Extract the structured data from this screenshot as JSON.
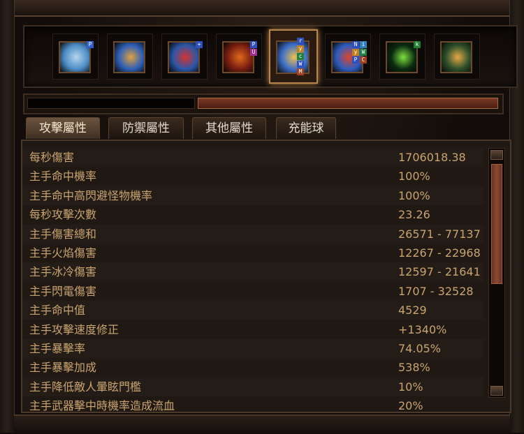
{
  "skills": [
    {
      "name": "skill-slot-1",
      "icon": "ghost-icon",
      "colors": [
        "#4c8dc7",
        "#b7d4ea"
      ],
      "runes": [
        {
          "t": "P",
          "bg": "#3060d0"
        }
      ]
    },
    {
      "name": "skill-slot-2",
      "icon": "vortex-icon",
      "colors": [
        "#2e5fb8",
        "#e0a23d"
      ],
      "runes": []
    },
    {
      "name": "skill-slot-3",
      "icon": "body-icon",
      "colors": [
        "#2c57a8",
        "#d7322e"
      ],
      "runes": [
        {
          "t": "+",
          "bg": "#3050c0"
        }
      ]
    },
    {
      "name": "skill-slot-4",
      "icon": "fire-icon",
      "colors": [
        "#7a1e10",
        "#e06a1c"
      ],
      "runes": [
        {
          "t": "P",
          "bg": "#3050c0"
        },
        {
          "t": "U",
          "bg": "#a03090"
        }
      ]
    },
    {
      "name": "skill-slot-5",
      "icon": "lightning-icon",
      "colors": [
        "#3b6ec9",
        "#f0c050"
      ],
      "runes": [
        {
          "t": "r",
          "bg": "#3050c0"
        },
        {
          "t": "y",
          "bg": "#c08020"
        },
        {
          "t": "c",
          "bg": "#208040"
        },
        {
          "t": "W",
          "bg": "#3050c0"
        },
        {
          "t": "M",
          "bg": "#a04020"
        }
      ],
      "active": true
    },
    {
      "name": "skill-slot-6",
      "icon": "storm-icon",
      "colors": [
        "#2f5dbf",
        "#e0452a"
      ],
      "runes": [
        {
          "t": "N",
          "bg": "#3050c0"
        },
        {
          "t": "y",
          "bg": "#c08020"
        },
        {
          "t": "P",
          "bg": "#3050c0"
        },
        {
          "t": "i",
          "bg": "#3080c0"
        },
        {
          "t": "W",
          "bg": "#208040"
        },
        {
          "t": "C",
          "bg": "#a04020"
        }
      ]
    },
    {
      "name": "skill-slot-7",
      "icon": "spear-icon",
      "colors": [
        "#0a2a10",
        "#7de040"
      ],
      "runes": [
        {
          "t": "k",
          "bg": "#208030"
        }
      ]
    },
    {
      "name": "skill-slot-8",
      "icon": "rune-icon",
      "colors": [
        "#2b4f2a",
        "#e5a846"
      ],
      "runes": []
    }
  ],
  "tabs": [
    "攻擊屬性",
    "防禦屬性",
    "其他屬性",
    "充能球"
  ],
  "stats": [
    {
      "label": "每秒傷害",
      "value": "1706018.38"
    },
    {
      "label": "主手命中機率",
      "value": "100%"
    },
    {
      "label": "主手命中高閃避怪物機率",
      "value": "100%"
    },
    {
      "label": "每秒攻擊次數",
      "value": "23.26"
    },
    {
      "label": "主手傷害總和",
      "value": "26571 - 77137"
    },
    {
      "label": "主手火焰傷害",
      "value": "12267 - 22968"
    },
    {
      "label": "主手冰冷傷害",
      "value": "12597 - 21641"
    },
    {
      "label": "主手閃電傷害",
      "value": "1707 - 32528"
    },
    {
      "label": "主手命中值",
      "value": "4529"
    },
    {
      "label": "主手攻擊速度修正",
      "value": "+1340%"
    },
    {
      "label": "主手暴擊率",
      "value": "74.05%"
    },
    {
      "label": "主手暴擊加成",
      "value": "538%"
    },
    {
      "label": "主手降低敵人暈眩門檻",
      "value": "10%"
    },
    {
      "label": "主手武器擊中時機率造成流血",
      "value": "20%"
    }
  ],
  "colors": {
    "text": "#c9a470",
    "accent": "#b8854e"
  }
}
